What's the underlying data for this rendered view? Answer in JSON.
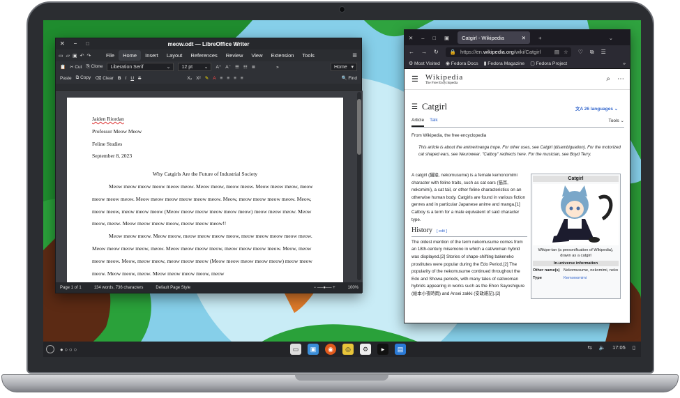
{
  "writer": {
    "title": "meow.odt — LibreOffice Writer",
    "menu": [
      "File",
      "Home",
      "Insert",
      "Layout",
      "References",
      "Review",
      "View",
      "Extension",
      "Tools"
    ],
    "active_menu": "Home",
    "cut": "Cut",
    "clone": "Clone",
    "paste": "Paste",
    "copy": "Copy",
    "clear": "Clear",
    "font": "Liberation Serif",
    "size": "12 pt",
    "style": "Home",
    "find": "Find",
    "doc": {
      "lines": [
        "Jaiden Riordan",
        "Professor Meow Meow",
        "Feline Studies",
        "September 8, 2023"
      ],
      "heading": "Why Catgirls Are the Future of Industrial Society",
      "p1": "Meow meow meow meow meow meow. Meow meow, meow meow.  Meow meow meow, meow meow meow meow. Meow meow meow meow meow meow. Meow, meow meow meow meow. Meow,  meow meow, meow meow meow (Meow meow meow meow meow meow) meow meow meow. Meow meow, meow. Meow meow meow meow, meow meow meow!!",
      "p2": "Meow meow meow. Meow meow, meow meow meow meow, meow meow meow meow meow.  Meow meow meow meow, meow. Meow meow meow meow, meow meow meow meow. Meow, meow meow meow. Meow,  meow meow, meow meow meow (Meow meow meow meow meow) meow meow meow. Meow meow, meow. Meow meow meow meow, meow"
    },
    "status": {
      "page": "Page 1 of 1",
      "words": "134 words, 736 characters",
      "style": "Default Page Style",
      "zoom": "100%"
    }
  },
  "firefox": {
    "tab_title": "Catgirl - Wikipedia",
    "url_prefix": "https://en.",
    "url_domain": "wikipedia.org",
    "url_path": "/wiki/Catgirl",
    "bookmarks": [
      "Most Visited",
      "Fedora Docs",
      "Fedora Magazine",
      "Fedora Project"
    ]
  },
  "wiki": {
    "logo": "Wikipedia",
    "tagline": "The Free Encyclopedia",
    "title": "Catgirl",
    "languages": "26 languages",
    "tab_article": "Article",
    "tab_talk": "Talk",
    "tools": "Tools",
    "from": "From Wikipedia, the free encyclopedia",
    "hatnote": "This article is about the anime/manga trope. For other uses, see Catgirl (disambiguation). For the motorized cat shaped ears, see Neurowear. \"Catboy\" redirects here. For the musician, see Boyd Terry.",
    "intro": "A catgirl (猫娘, nekomusume) is a female kemonomimi character with feline traits, such as cat ears (猫耳, nekomimi), a cat tail, or other feline characteristics on an otherwise human body. Catgirls are found in various fiction genres and in particular Japanese anime and manga.[1] Catboy is a term for a male equivalent of said character type.",
    "history_heading": "History",
    "edit": "[ edit ]",
    "history": "The oldest mention of the term nekomusume comes from an 18th-century misemono in which a cat/woman hybrid was displayed.[2] Stories of shape-shifting bakeneko prostitutes were popular during the Edo Period.[2] The popularity of the nekomusume continued throughout the Edo and Showa periods, with many tales of cat/woman hybrids appearing in works such as the Ehon Sayoshigure (絵本小夜時雨) and Ansei zakki (安政雑記).[2]",
    "infobox": {
      "title": "Catgirl",
      "caption": "Wikipe-tan (a personification of Wikipedia), drawn as a catgirl",
      "subheader": "In-universe information",
      "other_names_label": "Other name(s)",
      "other_names": "Nekomusume, nekomimi, neko",
      "type_label": "Type",
      "type": "Kemonomimi"
    }
  },
  "taskbar": {
    "time": "17:05"
  }
}
